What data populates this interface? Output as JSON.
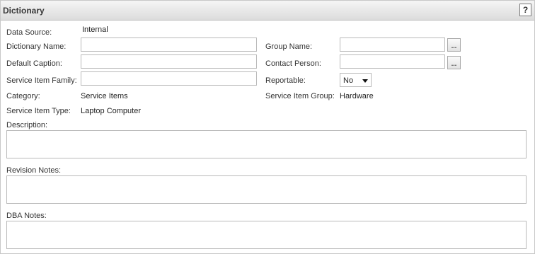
{
  "header": {
    "title": "Dictionary",
    "help_label": "?"
  },
  "fields": {
    "data_source": {
      "label": "Data Source:",
      "value": "Internal"
    },
    "dictionary_name": {
      "label": "Dictionary Name:",
      "value": ""
    },
    "group_name": {
      "label": "Group Name:",
      "value": "",
      "lookup": "..."
    },
    "default_caption": {
      "label": "Default Caption:",
      "value": ""
    },
    "contact_person": {
      "label": "Contact Person:",
      "value": "",
      "lookup": "..."
    },
    "service_item_family": {
      "label": "Service Item Family:",
      "value": ""
    },
    "reportable": {
      "label": "Reportable:",
      "value": "No"
    },
    "category": {
      "label": "Category:",
      "value": "Service Items"
    },
    "service_item_group": {
      "label": "Service Item Group:",
      "value": "Hardware"
    },
    "service_item_type": {
      "label": "Service Item Type:",
      "value": "Laptop Computer"
    },
    "description": {
      "label": "Description:",
      "value": ""
    },
    "revision_notes": {
      "label": "Revision Notes:",
      "value": ""
    },
    "dba_notes": {
      "label": "DBA Notes:",
      "value": ""
    }
  },
  "icons": {
    "reportable_dropdown": "chevron-down-icon"
  }
}
